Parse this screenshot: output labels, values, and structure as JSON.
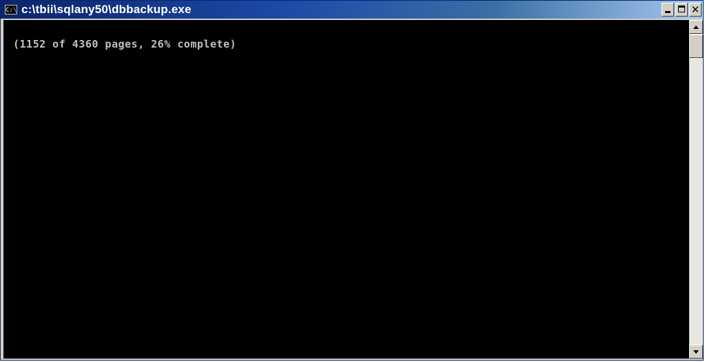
{
  "window": {
    "title": "c:\\tbii\\sqlany50\\dbbackup.exe",
    "icon_label": "C:\\",
    "buttons": {
      "minimize_icon": "minimize-icon",
      "maximize_icon": "maximize-icon",
      "close_label": "✕"
    }
  },
  "console": {
    "lines": [
      "(1152 of 4360 pages, 26% complete)"
    ],
    "background": "#000000",
    "text_color": "#c0c0c0"
  },
  "colors": {
    "titlebar_start": "#0a246a",
    "titlebar_end": "#a6caf0",
    "chrome": "#d4d0c8"
  }
}
